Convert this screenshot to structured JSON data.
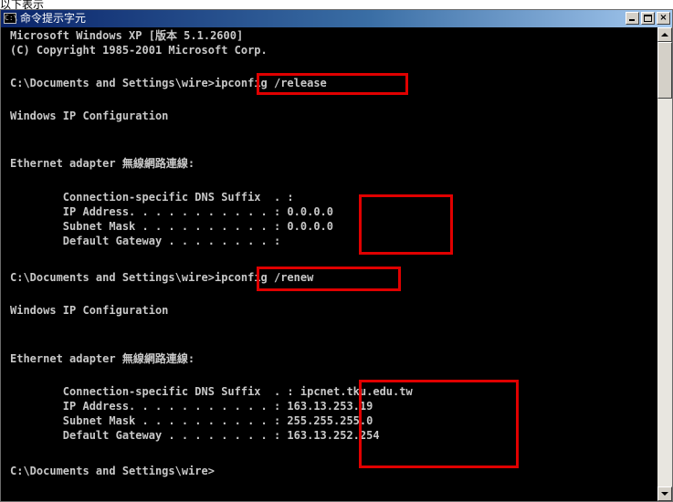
{
  "caption": "以下表示",
  "window": {
    "title": "命令提示字元",
    "icon": "console-icon",
    "buttons": {
      "minimize": "minimize-icon",
      "maximize": "maximize-icon",
      "close_label": "×"
    }
  },
  "console": {
    "lines": [
      "Microsoft Windows XP [版本 5.1.2600]",
      "(C) Copyright 1985-2001 Microsoft Corp.",
      "C:\\Documents and Settings\\wire>ipconfig /release",
      "Windows IP Configuration",
      "Ethernet adapter 無線網路連線:",
      "        Connection-specific DNS Suffix  . :",
      "        IP Address. . . . . . . . . . . : 0.0.0.0",
      "        Subnet Mask . . . . . . . . . . : 0.0.0.0",
      "        Default Gateway . . . . . . . . :",
      "C:\\Documents and Settings\\wire>ipconfig /renew",
      "Windows IP Configuration",
      "Ethernet adapter 無線網路連線:",
      "        Connection-specific DNS Suffix  . : ipcnet.tku.edu.tw",
      "        IP Address. . . . . . . . . . . : 163.13.253.19",
      "        Subnet Mask . . . . . . . . . . : 255.255.255.0",
      "        Default Gateway . . . . . . . . : 163.13.252.254",
      "C:\\Documents and Settings\\wire>"
    ]
  },
  "colors": {
    "console_background": "#000000",
    "console_text": "#c8c8c8",
    "highlight_border": "#e00000",
    "title_gradient_start": "#0a246a"
  }
}
